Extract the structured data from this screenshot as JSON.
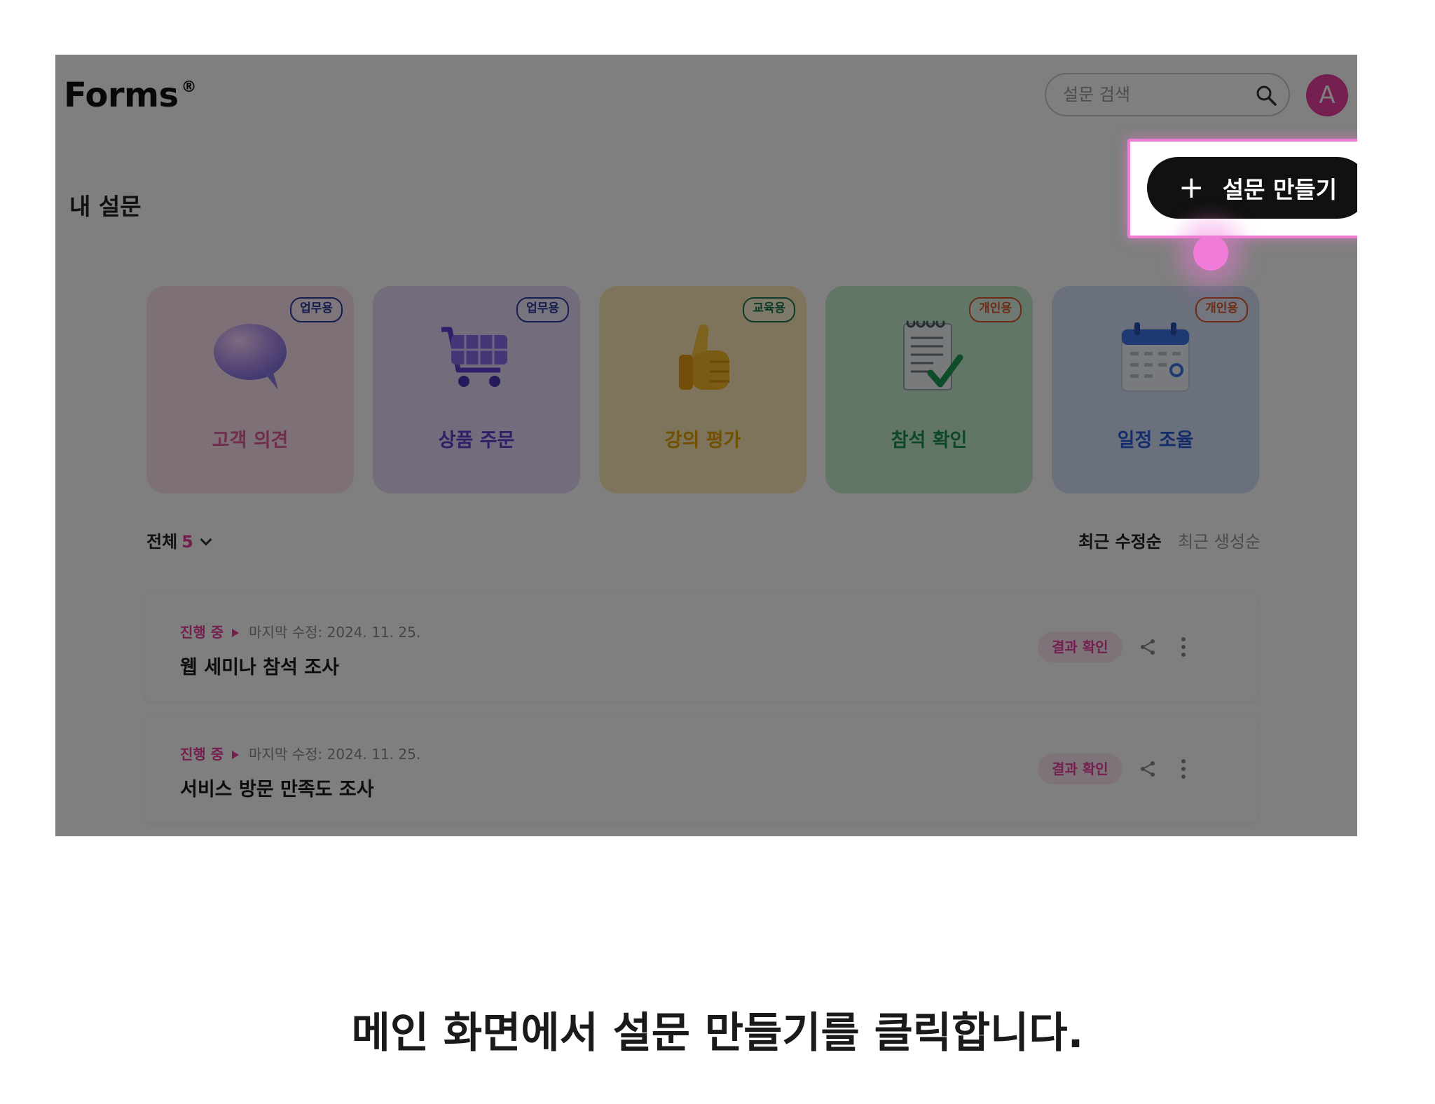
{
  "app": {
    "logo": "Forms",
    "logo_mark": "®"
  },
  "header": {
    "search_placeholder": "설문 검색",
    "avatar_initial": "A"
  },
  "page": {
    "title": "내 설문"
  },
  "actions": {
    "create_label": "설문 만들기"
  },
  "templates": [
    {
      "label": "고객 의견",
      "badge": "업무용",
      "icon": "speech-bubble-icon"
    },
    {
      "label": "상품 주문",
      "badge": "업무용",
      "icon": "shopping-cart-icon"
    },
    {
      "label": "강의 평가",
      "badge": "교육용",
      "icon": "thumbs-up-icon"
    },
    {
      "label": "참석 확인",
      "badge": "개인용",
      "icon": "checklist-icon"
    },
    {
      "label": "일정 조율",
      "badge": "개인용",
      "icon": "calendar-icon"
    }
  ],
  "list": {
    "filter_label": "전체",
    "count": "5",
    "sort_options": [
      "최근 수정순",
      "최근 생성순"
    ],
    "items": [
      {
        "status": "진행 중",
        "modified": "마지막 수정: 2024. 11. 25.",
        "title": "웹 세미나 참석 조사",
        "result_label": "결과 확인"
      },
      {
        "status": "진행 중",
        "modified": "마지막 수정: 2024. 11. 25.",
        "title": "서비스 방문 만족도 조사",
        "result_label": "결과 확인"
      }
    ]
  },
  "caption": "메인 화면에서 설문 만들기를 클릭합니다.",
  "colors": {
    "accent": "#e83ea0",
    "highlight_border": "#ef7fd4",
    "card_pink": "#fbe1ee",
    "card_purple": "#e6d9fb",
    "card_yellow": "#fde9b8",
    "card_green": "#c5ecd0",
    "card_blue": "#d6e0fb"
  }
}
